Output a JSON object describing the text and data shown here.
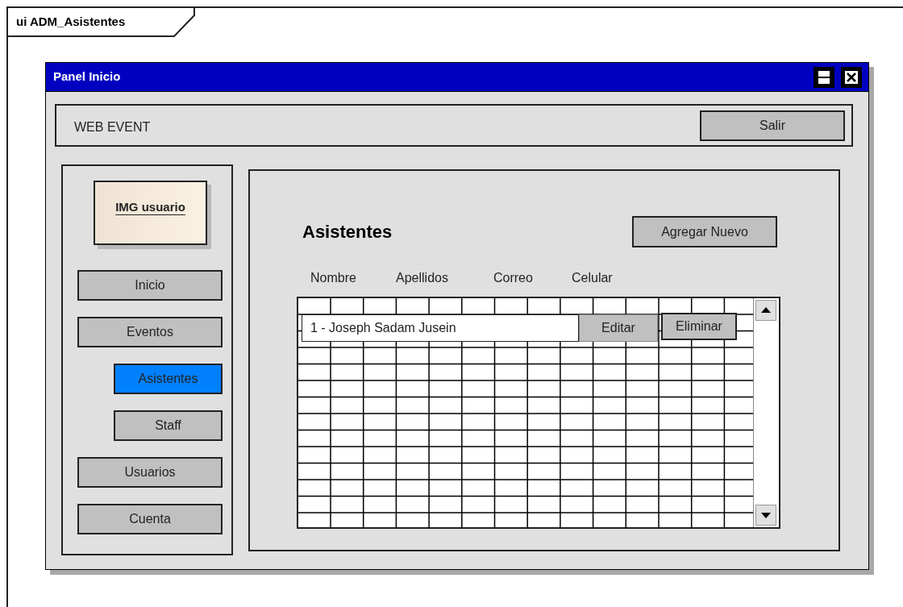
{
  "diagram": {
    "title": "ui ADM_Asistentes"
  },
  "window": {
    "title": "Panel Inicio"
  },
  "header": {
    "brand": "WEB EVENT",
    "button": "Salir"
  },
  "sidebar": {
    "image_label": "IMG usuario",
    "items": [
      {
        "label": "Inicio",
        "kind": "main",
        "selected": false
      },
      {
        "label": "Eventos",
        "kind": "main",
        "selected": false
      },
      {
        "label": "Asistentes",
        "kind": "sub",
        "selected": true
      },
      {
        "label": "Staff",
        "kind": "sub",
        "selected": false
      },
      {
        "label": "Usuarios",
        "kind": "main",
        "selected": false
      },
      {
        "label": "Cuenta",
        "kind": "main",
        "selected": false
      }
    ]
  },
  "content": {
    "title": "Asistentes",
    "add_button": "Agregar Nuevo",
    "columns": [
      "Nombre",
      "Apellidos",
      "Correo",
      "Celular"
    ],
    "rows": [
      {
        "text": "1 - Joseph Sadam Jusein",
        "actions": [
          "Editar",
          "Eliminar"
        ]
      }
    ]
  }
}
